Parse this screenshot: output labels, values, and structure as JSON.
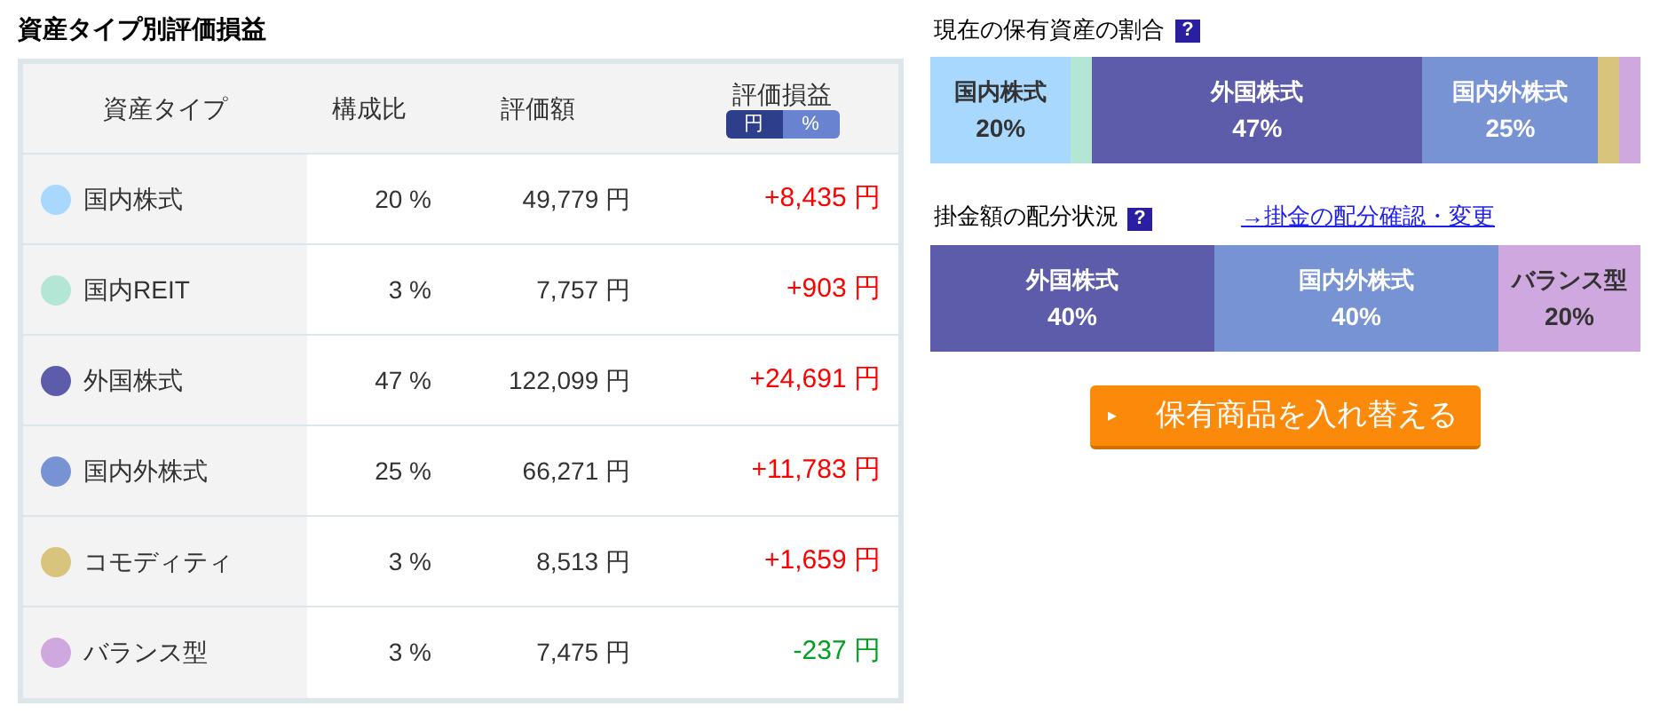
{
  "table_title": "資産タイプ別評価損益",
  "table": {
    "columns": [
      "資産タイプ",
      "構成比",
      "評価額",
      "評価損益"
    ],
    "unit_toggle": [
      {
        "label": "円",
        "selected": true
      },
      {
        "label": "%",
        "selected": false
      }
    ],
    "rows": [
      {
        "name": "国内株式",
        "color": "#a8d8fe",
        "ratio": "20 %",
        "value": "49,779 円",
        "gain": "+8,435 円",
        "negative": false
      },
      {
        "name": "国内REIT",
        "color": "#b3e6d4",
        "ratio": "3 %",
        "value": "7,757 円",
        "gain": "+903 円",
        "negative": false
      },
      {
        "name": "外国株式",
        "color": "#5c5cab",
        "ratio": "47 %",
        "value": "122,099 円",
        "gain": "+24,691 円",
        "negative": false
      },
      {
        "name": "国内外株式",
        "color": "#7893d4",
        "ratio": "25 %",
        "value": "66,271 円",
        "gain": "+11,783 円",
        "negative": false
      },
      {
        "name": "コモディティ",
        "color": "#d8c47c",
        "ratio": "3 %",
        "value": "8,513 円",
        "gain": "+1,659 円",
        "negative": false
      },
      {
        "name": "バランス型",
        "color": "#d0a8e0",
        "ratio": "3 %",
        "value": "7,475 円",
        "gain": "-237 円",
        "negative": true
      }
    ]
  },
  "holdings": {
    "title": "現在の保有資産の割合",
    "help": "?",
    "segments": [
      {
        "name": "国内株式",
        "percent": "20%",
        "color": "#a8d8fe"
      },
      {
        "color": "#b3e6d4"
      },
      {
        "name": "外国株式",
        "percent": "47%",
        "color": "#5c5cab"
      },
      {
        "name": "国内外株式",
        "percent": "25%",
        "color": "#7893d4"
      },
      {
        "color": "#d8c47c"
      },
      {
        "color": "#d0a8e0"
      }
    ]
  },
  "allocation": {
    "title": "掛金額の配分状況",
    "help": "?",
    "link": "→掛金の配分確認・変更",
    "segments": [
      {
        "name": "外国株式",
        "percent": "40%",
        "color": "#5c5cab"
      },
      {
        "name": "国内外株式",
        "percent": "40%",
        "color": "#7893d4"
      },
      {
        "name": "バランス型",
        "percent": "20%",
        "color": "#d0a8e0"
      }
    ]
  },
  "switch_button": {
    "icon": "▸",
    "label": "保有商品を入れ替える"
  }
}
